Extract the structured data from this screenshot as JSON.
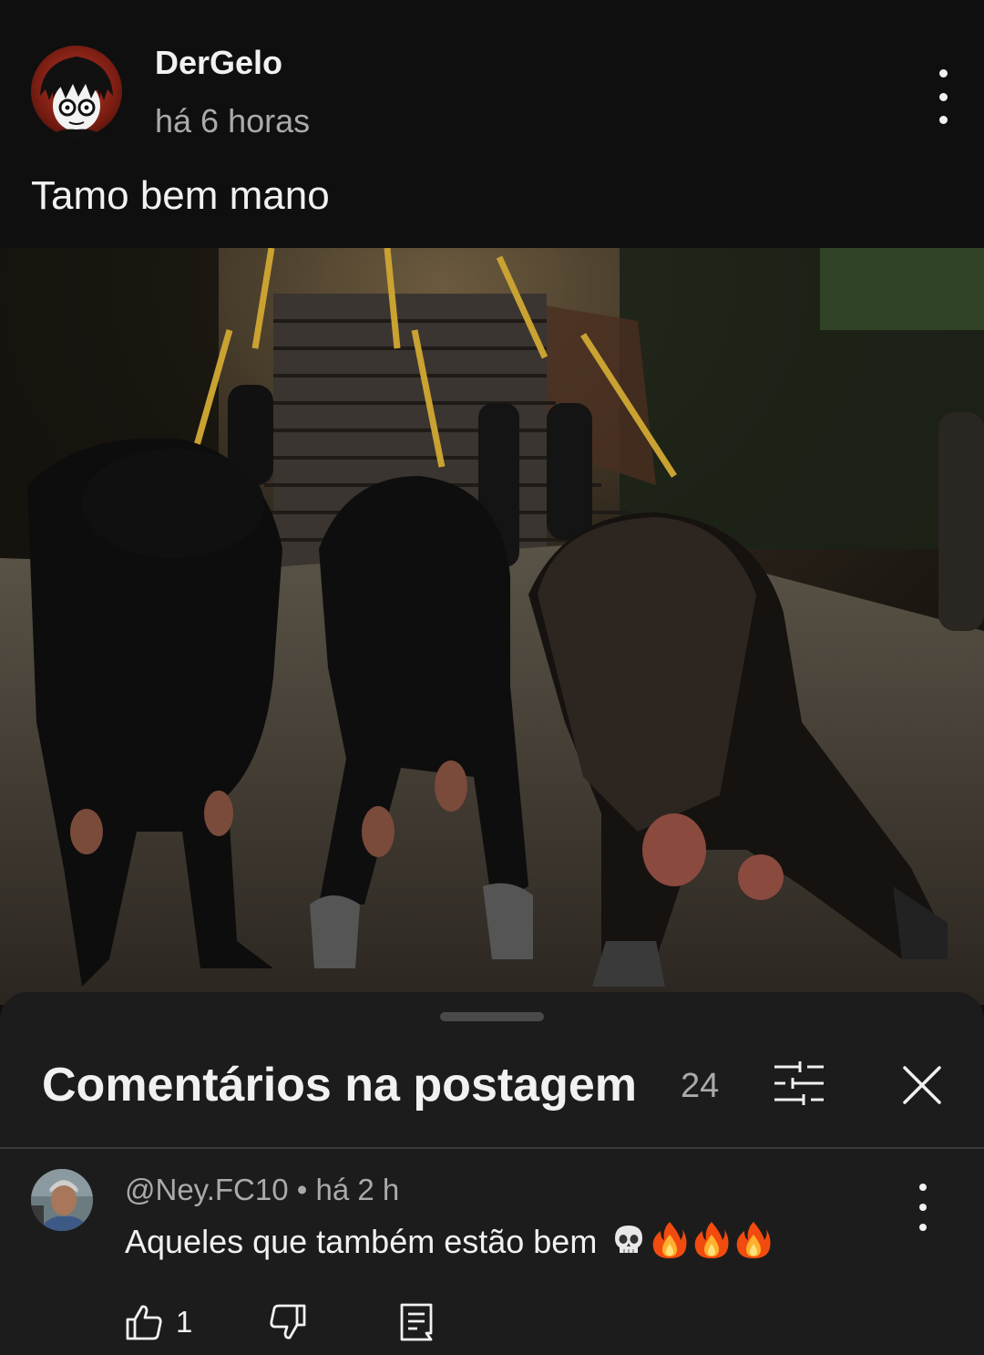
{
  "post": {
    "author": "DerGelo",
    "time": "há 6 horas",
    "text": "Tamo bem mano",
    "menu_icon": "more-vert-icon"
  },
  "photo": {
    "description_icon": "post-image"
  },
  "comments_sheet": {
    "title": "Comentários na postagem",
    "count": "24",
    "filter_icon": "sort-filter-icon",
    "close_icon": "close-icon"
  },
  "comment": {
    "author": "@Ney.FC10",
    "separator": " • ",
    "time": "há 2 h",
    "text": "Aqueles que também estão bem",
    "emojis": [
      "skull",
      "fire",
      "fire",
      "fire"
    ],
    "likes": "1"
  },
  "colors": {
    "background": "#0f0f0f",
    "sheet": "#1c1c1c",
    "text_primary": "#f1f1f1",
    "text_secondary": "#aaaaaa"
  }
}
